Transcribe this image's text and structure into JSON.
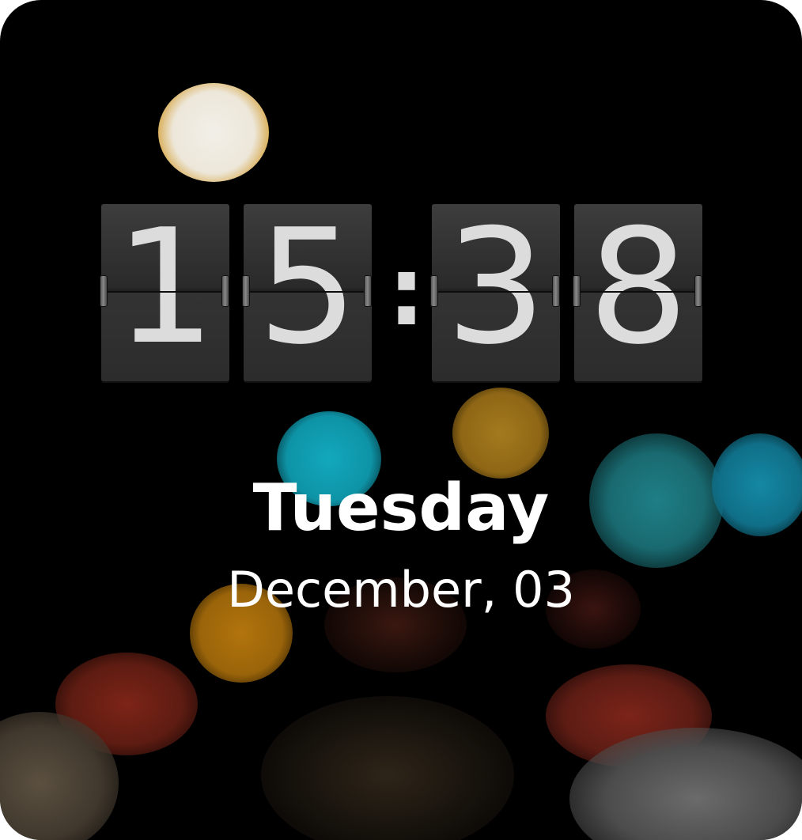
{
  "clock": {
    "hour_tens": "1",
    "hour_ones": "5",
    "separator": ":",
    "minute_tens": "3",
    "minute_ones": "8"
  },
  "date": {
    "weekday": "Tuesday",
    "month_day": "December, 03"
  },
  "colors": {
    "background": "#000000",
    "digit_text": "#dcdcdc",
    "flip_card": "#2e2e2e",
    "date_text": "#ffffff"
  }
}
